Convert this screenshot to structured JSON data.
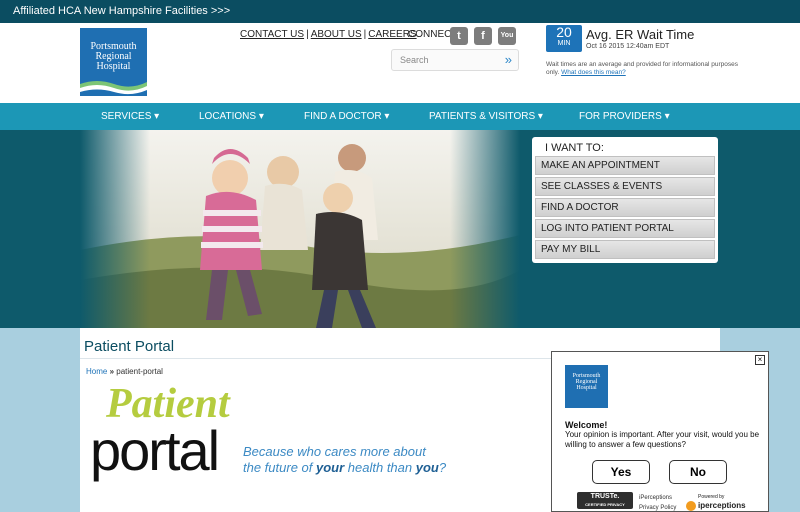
{
  "topbar": {
    "text": "Affiliated HCA New Hampshire Facilities >>>"
  },
  "header": {
    "logo": {
      "line1": "Portsmouth",
      "line2": "Regional",
      "line3": "Hospital"
    },
    "links": [
      "CONTACT US",
      "ABOUT US",
      "CAREERS"
    ],
    "connect_label": "CONNECT",
    "social": [
      {
        "icon": "twitter-icon",
        "glyph": "t"
      },
      {
        "icon": "facebook-icon",
        "glyph": "f"
      },
      {
        "icon": "youtube-icon",
        "glyph": "You"
      }
    ],
    "search": {
      "placeholder": "Search",
      "go": "»"
    }
  },
  "wait_time": {
    "value": "20",
    "unit": "MIN",
    "title": "Avg. ER Wait Time",
    "date": "Oct 16 2015 12:40am EDT",
    "note": "Wait times are an average and provided for informational purposes only.",
    "link": "What does this mean?"
  },
  "nav": {
    "items": [
      "SERVICES",
      "LOCATIONS",
      "FIND A DOCTOR",
      "PATIENTS & VISITORS",
      "FOR PROVIDERS"
    ],
    "caret": "▾"
  },
  "iwant": {
    "heading": "I WANT TO:",
    "options": [
      "MAKE AN APPOINTMENT",
      "SEE CLASSES & EVENTS",
      "FIND A DOCTOR",
      "LOG INTO PATIENT PORTAL",
      "PAY MY BILL"
    ]
  },
  "content": {
    "page_title": "Patient Portal",
    "breadcrumb": {
      "home": "Home",
      "sep": "»",
      "current": "patient-portal"
    },
    "banner": {
      "word1": "Patient",
      "word2": "portal"
    },
    "tagline": {
      "line1": "Because who cares more about",
      "line2_a": "the future of ",
      "line2_b": "your",
      "line2_c": " health than ",
      "line2_d": "you",
      "line2_e": "?"
    }
  },
  "survey": {
    "close": "×",
    "logo": {
      "line1": "Portsmouth",
      "line2": "Regional",
      "line3": "Hospital"
    },
    "welcome": "Welcome!",
    "message": "Your opinion is important. After your visit, would you be willing to answer a few questions?",
    "yes": "Yes",
    "no": "No",
    "truste_line1": "TRUSTe.",
    "truste_line2": "CERTIFIED PRIVACY",
    "ip_line1": "iPerceptions",
    "ip_line2": "Privacy Policy",
    "powered_line1": "Powered by",
    "powered_line2": "iperceptions"
  },
  "colors": {
    "topbar": "#0b4d61",
    "nav": "#1c97b6",
    "accent": "#1e73b8",
    "hero": "#0e5a6b"
  }
}
